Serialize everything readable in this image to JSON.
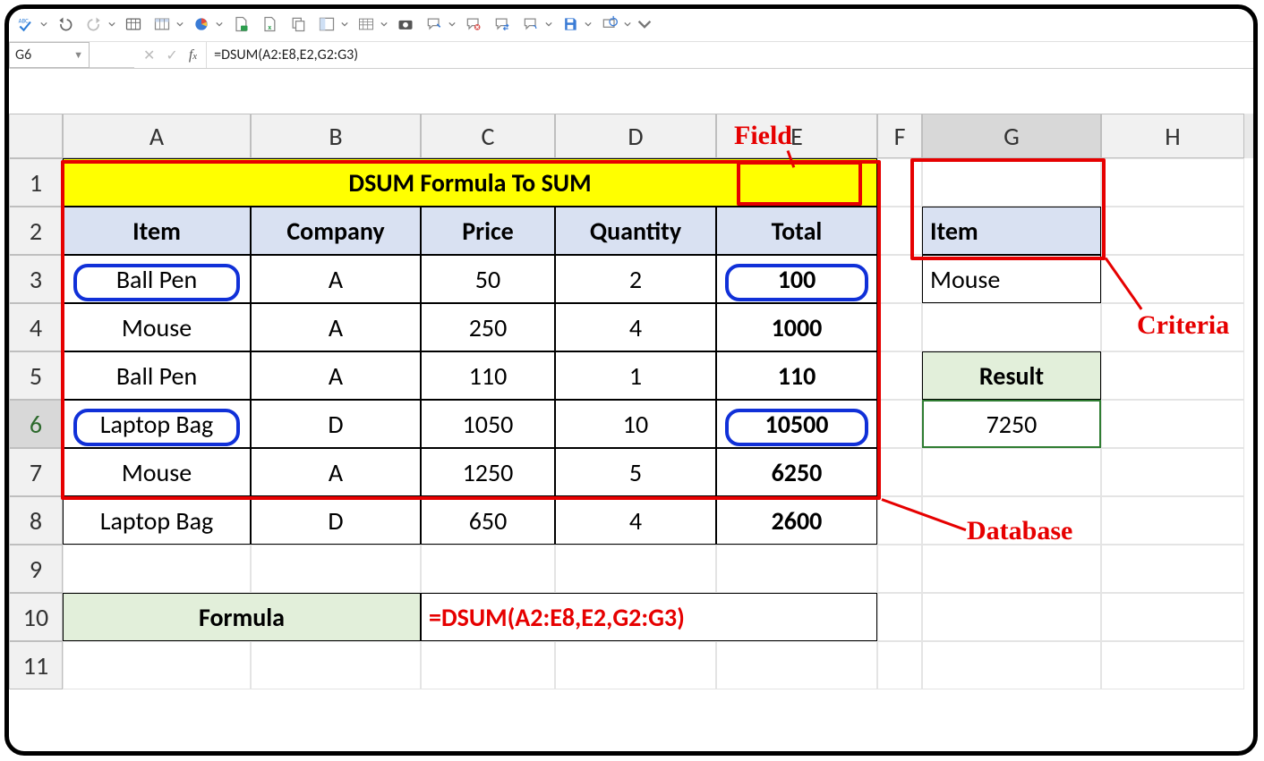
{
  "namebox": "G6",
  "formula_bar": "=DSUM(A2:E8,E2,G2:G3)",
  "columns": [
    "",
    "A",
    "B",
    "C",
    "D",
    "E",
    "F",
    "G",
    "H"
  ],
  "row_numbers": [
    "1",
    "2",
    "3",
    "4",
    "5",
    "6",
    "7",
    "8",
    "9",
    "10",
    "11"
  ],
  "title": "DSUM Formula To SUM",
  "table": {
    "headers": [
      "Item",
      "Company",
      "Price",
      "Quantity",
      "Total"
    ],
    "rows": [
      {
        "item": "Ball Pen",
        "company": "A",
        "price": "50",
        "qty": "2",
        "total": "100"
      },
      {
        "item": "Mouse",
        "company": "A",
        "price": "250",
        "qty": "4",
        "total": "1000"
      },
      {
        "item": "Ball Pen",
        "company": "A",
        "price": "110",
        "qty": "1",
        "total": "110"
      },
      {
        "item": "Laptop Bag",
        "company": "D",
        "price": "1050",
        "qty": "10",
        "total": "10500"
      },
      {
        "item": "Mouse",
        "company": "A",
        "price": "1250",
        "qty": "5",
        "total": "6250"
      },
      {
        "item": "Laptop Bag",
        "company": "D",
        "price": "650",
        "qty": "4",
        "total": "2600"
      }
    ]
  },
  "criteria": {
    "header": "Item",
    "value": "Mouse"
  },
  "result": {
    "label": "Result",
    "value": "7250"
  },
  "formula_row": {
    "label": "Formula",
    "value": "=DSUM(A2:E8,E2,G2:G3)"
  },
  "annotations": {
    "field": "Field",
    "criteria": "Criteria",
    "database": "Database"
  },
  "icons": {
    "spellcheck": "ABC✓",
    "undo": "↶",
    "redo": "↷",
    "table": "▦",
    "pie": "◔",
    "doc": "🗎",
    "xls": "x",
    "dup": "⿻",
    "layout": "▥",
    "grid": "▤",
    "camera": "📷",
    "arrow1": "↘",
    "arrow2": "⊘",
    "arrow3": "⇄",
    "arrow4": "↝",
    "save": "💾",
    "refresh": "⟲",
    "more": "▾"
  }
}
